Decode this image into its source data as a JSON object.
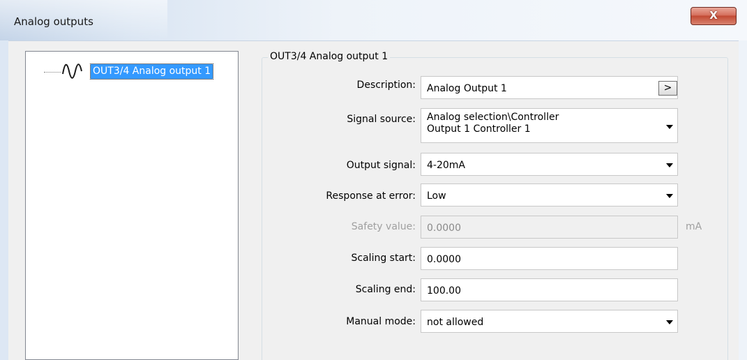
{
  "window": {
    "title": "Analog outputs",
    "close_glyph": "X"
  },
  "tree": {
    "items": [
      {
        "label": "OUT3/4 Analog output 1",
        "icon": "sine-wave-icon"
      }
    ]
  },
  "group": {
    "title": "OUT3/4 Analog output 1"
  },
  "form": {
    "description": {
      "label": "Description:",
      "value": "Analog Output 1",
      "button": ">"
    },
    "signal_source": {
      "label": "Signal source:",
      "value_line1": "Analog selection\\Controller",
      "value_line2": "Output 1 Controller 1"
    },
    "output_signal": {
      "label": "Output signal:",
      "value": "4-20mA"
    },
    "response_at_error": {
      "label": "Response at error:",
      "value": "Low"
    },
    "safety_value": {
      "label": "Safety value:",
      "value": "0.0000",
      "unit": "mA",
      "disabled": true
    },
    "scaling_start": {
      "label": "Scaling start:",
      "value": "0.0000"
    },
    "scaling_end": {
      "label": "Scaling end:",
      "value": "100.00"
    },
    "manual_mode": {
      "label": "Manual mode:",
      "value": "not allowed"
    }
  },
  "colors": {
    "selection": "#3399ff",
    "close_button": "#c24a33",
    "dialog_background": "#f0f0f0"
  }
}
